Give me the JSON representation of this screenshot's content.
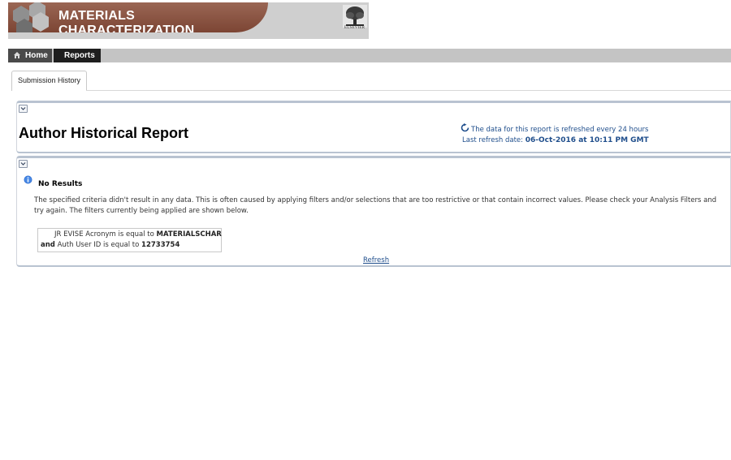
{
  "header": {
    "journal_title": "MATERIALS CHARACTERIZATION",
    "publisher_logo_text": "ELSEVIER"
  },
  "nav": {
    "home_label": "Home",
    "reports_label": "Reports"
  },
  "tabs": [
    {
      "label": "Submission History",
      "active": true
    }
  ],
  "report": {
    "title": "Author Historical Report",
    "refresh_note": "The data for this report is refreshed every 24 hours",
    "last_refresh_label": "Last refresh date:",
    "last_refresh_date": "06-Oct-2016 at 10:11 PM GMT"
  },
  "results": {
    "heading": "No Results",
    "message": "The specified criteria didn't result in any data. This is often caused by applying filters and/or selections that are too restrictive or that contain incorrect values. Please check your Analysis Filters and try again. The filters currently being applied are shown below.",
    "filters": {
      "filter1_text": "JR EVISE Acronym is equal to",
      "filter1_value": "MATERIALSCHAR",
      "conjunction": "and",
      "filter2_text": "Auth User ID is equal to",
      "filter2_value": "12733754"
    },
    "refresh_link": "Refresh"
  },
  "icons": {
    "home": "home-icon",
    "collapse": "chevron-down-icon",
    "refresh": "refresh-icon",
    "info": "info-icon",
    "logo": "elsevier-tree-logo"
  },
  "colors": {
    "banner_brown": "#8a5444",
    "banner_gray": "#cfcfcf",
    "nav_active": "#1e1e1e",
    "link_blue": "#1f4e8c"
  }
}
